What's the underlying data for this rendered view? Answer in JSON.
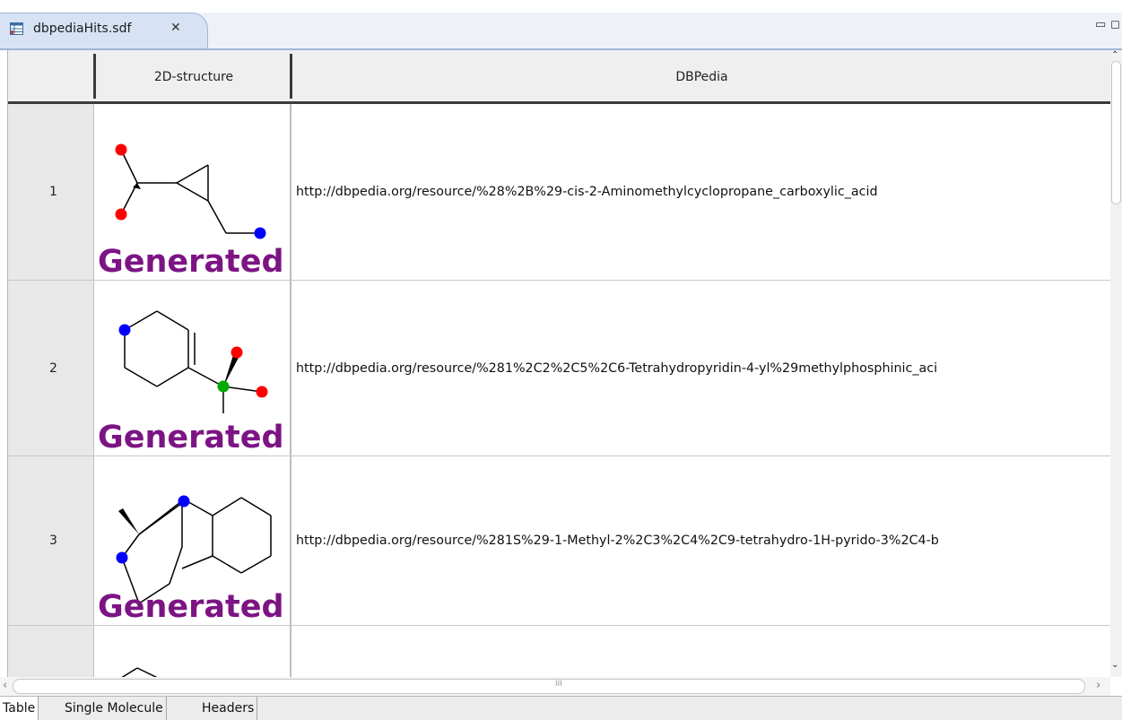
{
  "editor_tab": {
    "title": "dbpediaHits.sdf",
    "close_glyph": "✕",
    "minimize_glyph": "▭",
    "maximize_glyph": "◻"
  },
  "table": {
    "columns": [
      "",
      "2D-structure",
      "DBPedia"
    ],
    "rows": [
      {
        "index": "1",
        "badge": "Generated",
        "url": "http://dbpedia.org/resource/%28%2B%29-cis-2-Aminomethylcyclopropane_carboxylic_acid"
      },
      {
        "index": "2",
        "badge": "Generated",
        "url": "http://dbpedia.org/resource/%281%2C2%2C5%2C6-Tetrahydropyridin-4-yl%29methylphosphinic_aci"
      },
      {
        "index": "3",
        "badge": "Generated",
        "url": "http://dbpedia.org/resource/%281S%29-1-Methyl-2%2C3%2C4%2C9-tetrahydro-1H-pyrido-3%2C4-b"
      },
      {
        "index": "",
        "badge": "",
        "url": ""
      }
    ]
  },
  "scrollbars": {
    "grip": "III",
    "left_arrow": "‹",
    "right_arrow": "›",
    "up_arrow": "⌃",
    "down_arrow": "⌄"
  },
  "page_tabs": [
    "Table",
    "Single Molecule",
    "Headers"
  ],
  "colors": {
    "generated_badge": "#7c1484",
    "oxygen_atom": "#ff0000",
    "nitrogen_atom": "#0000ff",
    "phosphorus_atom": "#00aa00"
  },
  "icons": [
    "table-file-icon",
    "close-icon",
    "minimize-icon",
    "maximize-icon"
  ]
}
